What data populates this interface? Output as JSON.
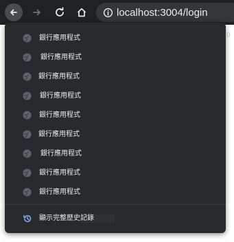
{
  "browser": {
    "url": "localhost:3004/login",
    "peek_text": "0"
  },
  "history_menu": {
    "items": [
      {
        "label": "銀行應用程式"
      },
      {
        "label": "銀行應用程式"
      },
      {
        "label": "銀行應用程式"
      },
      {
        "label": "銀行應用程式"
      },
      {
        "label": "銀行應用程式"
      },
      {
        "label": "銀行應用程式"
      },
      {
        "label": "銀行應用程式"
      },
      {
        "label": "銀行應用程式"
      },
      {
        "label": "銀行應用程式"
      }
    ],
    "show_all_label": "顯示完整歷史記錄"
  },
  "colors": {
    "toolbar_bg": "#202124",
    "menu_bg": "#292a2d",
    "text": "#e8eaed",
    "history_icon": "#8ab4f8"
  },
  "icons": {
    "back": "back-arrow-icon",
    "forward": "forward-arrow-icon",
    "reload": "reload-icon",
    "home": "home-icon",
    "info": "info-icon",
    "item": "globe-icon",
    "history": "history-icon"
  }
}
